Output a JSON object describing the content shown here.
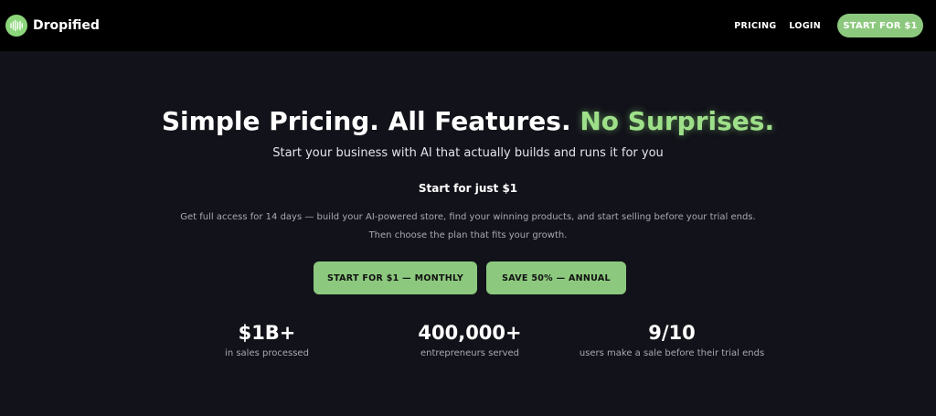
{
  "nav": {
    "brand": "Dropified",
    "links": [
      "PRICING",
      "LOGIN"
    ],
    "cta": "START FOR $1"
  },
  "hero": {
    "headline_main": "Simple Pricing. All Features.",
    "headline_accent": "No Surprises.",
    "subheadline": "Start your business with AI that actually builds and runs it for you",
    "offer": "Start for just $1",
    "description_line1": "Get full access for 14 days — build your AI-powered store, find your winning products, and start selling before your trial ends.",
    "description_line2": "Then choose the plan that fits your growth.",
    "buttons": {
      "monthly": "START FOR $1 — MONTHLY",
      "annual": "SAVE 50% — ANNUAL"
    }
  },
  "stats": [
    {
      "value": "$1B+",
      "label": "in sales processed"
    },
    {
      "value": "400,000+",
      "label": "entrepreneurs served"
    },
    {
      "value": "9/10",
      "label": "users make a sale before their trial ends"
    }
  ],
  "colors": {
    "accent": "#8cc97e",
    "accent_glow": "#9ee08a",
    "background": "#12121a",
    "nav_background": "#000000"
  },
  "icons": {
    "logo": "soundwave-logo-icon"
  }
}
